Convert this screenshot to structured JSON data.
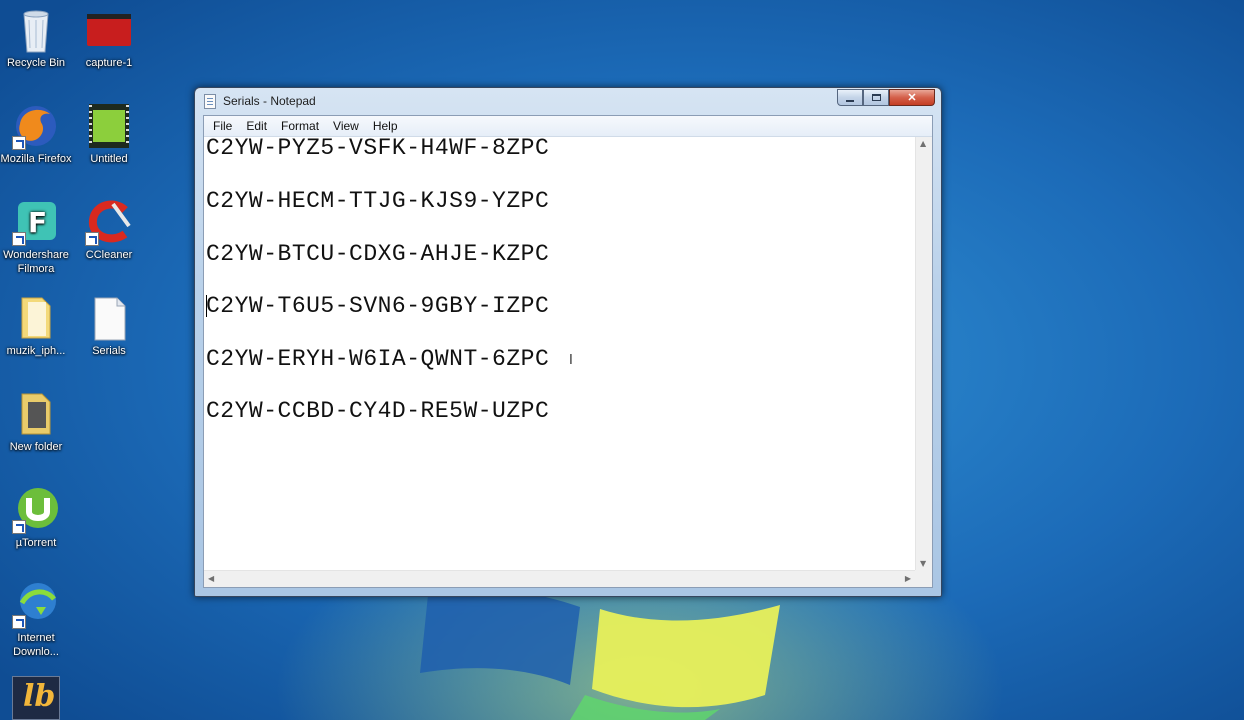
{
  "desktop": {
    "icons": [
      {
        "label": "Recycle Bin",
        "icon": "recycle-bin-icon"
      },
      {
        "label": "capture-1",
        "icon": "video-file-icon"
      },
      {
        "label": "Mozilla Firefox",
        "icon": "firefox-icon"
      },
      {
        "label": "Untitled",
        "icon": "video-clip-icon"
      },
      {
        "label": "Wondershare Filmora",
        "icon": "filmora-icon"
      },
      {
        "label": "CCleaner",
        "icon": "ccleaner-icon"
      },
      {
        "label": "muzik_iph...",
        "icon": "folder-icon"
      },
      {
        "label": "Serials",
        "icon": "text-file-icon"
      },
      {
        "label": "New folder",
        "icon": "folder-icon"
      },
      {
        "label": "µTorrent",
        "icon": "utorrent-icon"
      },
      {
        "label": "Internet Downlo...",
        "icon": "idm-icon"
      }
    ]
  },
  "window": {
    "title": "Serials - Notepad",
    "buttons": {
      "minimize": "minimize-icon",
      "maximize": "maximize-icon",
      "close": "close-icon"
    },
    "menu": [
      "File",
      "Edit",
      "Format",
      "View",
      "Help"
    ],
    "lines": [
      "C2YW-PYZ5-VSFK-H4WF-8ZPC",
      "C2YW-HECM-TTJG-KJS9-YZPC",
      "C2YW-BTCU-CDXG-AHJE-KZPC",
      "C2YW-T6U5-SVN6-9GBY-IZPC",
      "C2YW-ERYH-W6IA-QWNT-6ZPC",
      "C2YW-CCBD-CY4D-RE5W-UZPC"
    ]
  },
  "colors": {
    "desktop_blue": "#1c6bb8",
    "window_frame": "#b9d1ea",
    "close_red": "#c43e25"
  }
}
